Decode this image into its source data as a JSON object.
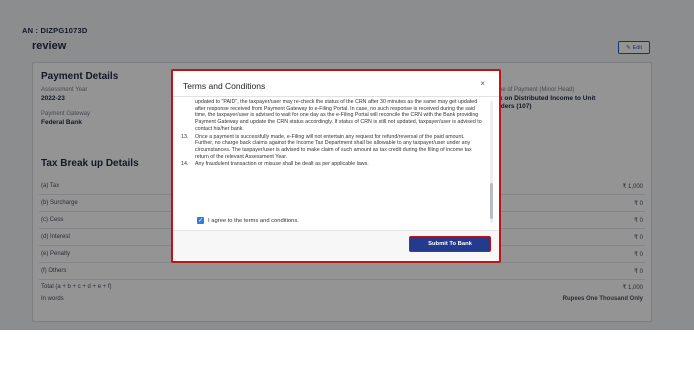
{
  "pan_text": "AN : DIZPG1073D",
  "preview_title": "review",
  "edit_label": "Edit",
  "payment_details": {
    "title": "Payment Details",
    "assessment_year_label": "Assessment Year",
    "assessment_year_value": "2022-23",
    "gateway_label": "Payment Gateway",
    "gateway_value": "Federal Bank",
    "minor_head_label": "pe of Payment (Minor Head)",
    "minor_head_value_1": "x on Distributed Income to Unit",
    "minor_head_value_2": "lders (107)"
  },
  "tax_breakup": {
    "title": "Tax Break up Details",
    "rows": [
      {
        "label": "(a) Tax",
        "value": "₹ 1,000"
      },
      {
        "label": "(b) Surcharge",
        "value": "₹ 0"
      },
      {
        "label": "(c) Cess",
        "value": "₹ 0"
      },
      {
        "label": "(d) Interest",
        "value": "₹ 0"
      },
      {
        "label": "(e) Penalty",
        "value": "₹ 0"
      },
      {
        "label": "(f) Others",
        "value": "₹ 0"
      }
    ],
    "total_label": "Total (a + b + c + d + e + f)",
    "total_value": "₹ 1,000",
    "words_label": "In words",
    "words_value": "Rupees One Thousand Only"
  },
  "modal": {
    "title": "Terms and Conditions",
    "close": "×",
    "para_cont": "updated to \"PAID\", the taxpayer/user may re-check the status of the CRN after 30 minutes as the same may get updated after response received from Payment Gateway to e-Filing Portal. In case, no such response is received during the said time, the taxpayer/user is advised to wait for one day as the e-Filing Portal will reconcile the CRN with the Bank providing Payment Gateway and update the CRN status accordingly. If status of CRN is still not updated, taxpayer/user is advised to contact his/her bank.",
    "item13_num": "13.",
    "item13_text": "Once a payment is successfully made, e-Filing will not entertain any request for refund/reversal of the paid amount. Further, no charge back claims against the Income Tax Department shall be allowable to any taxpayer/user under any circumstances. The taxpayer/user is advised to make claim of such amount as tax credit during the filing of income tax return of the relevant Assessment Year.",
    "item14_num": "14.",
    "item14_text": "Any fraudulent transaction or misuse shall be dealt as per applicable laws.",
    "agree_label": "I agree to the terms and conditions.",
    "submit_label": "Submit To Bank"
  }
}
